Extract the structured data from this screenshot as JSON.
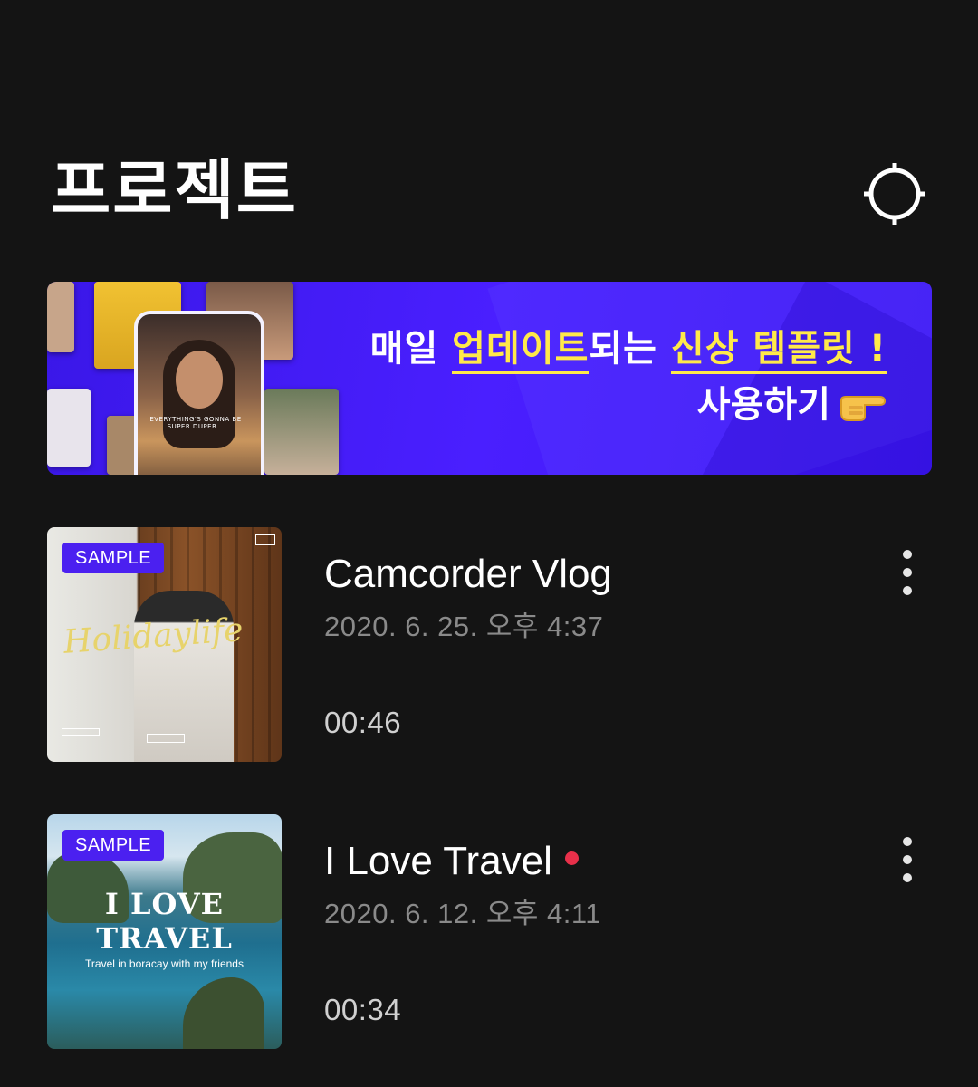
{
  "header": {
    "title": "프로젝트",
    "settings_icon": "gear-icon"
  },
  "banner": {
    "line1_part1": "매일 ",
    "line1_highlight1": "업데이트",
    "line1_part2": "되는 ",
    "line1_highlight2": "신상 템플릿 !",
    "line2": "사용하기",
    "pointer_icon": "pointing-hand-icon",
    "collage_caption": "EVERYTHING'S GONNA BE SUPER DUPER...",
    "accent_color": "#4a1fff",
    "highlight_color": "#ffe94a"
  },
  "projects": [
    {
      "badge": "SAMPLE",
      "title": "Camcorder Vlog",
      "date": "2020. 6. 25. 오후 4:37",
      "duration": "00:46",
      "thumbnail_text": "Holidaylife",
      "is_new": false
    },
    {
      "badge": "SAMPLE",
      "title": "I Love Travel",
      "date": "2020. 6. 12. 오후 4:11",
      "duration": "00:34",
      "thumbnail_title_line1": "I LOVE",
      "thumbnail_title_line2": "TRAVEL",
      "thumbnail_subtitle": "Travel in boracay with my friends",
      "is_new": true,
      "new_dot_color": "#e8304a"
    }
  ]
}
